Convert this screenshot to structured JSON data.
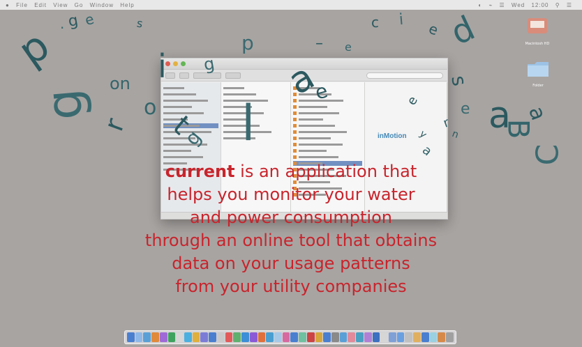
{
  "menubar": {
    "left_items": [
      "●",
      "File",
      "Edit",
      "View",
      "Go",
      "Window",
      "Help"
    ],
    "right_items": [
      "◐",
      "⌁",
      "☰",
      "Wed",
      "12:00",
      "⚲",
      "☰"
    ]
  },
  "window": {
    "col1_rows": 14,
    "col2_rows": 9,
    "col3_rows": 18,
    "logo_text": "inMotion",
    "status_text": "…"
  },
  "desktop_icons": [
    {
      "name": "hard-drive",
      "label": "Macintosh HD"
    },
    {
      "name": "folder",
      "label": "Folder"
    }
  ],
  "description": {
    "brand": "current",
    "lines": [
      " is an application that",
      "helps you monitor your water",
      "and power consumption",
      "through an online tool that obtains",
      "data on your usage patterns",
      "from your utility companies"
    ]
  },
  "floating_letters": [
    {
      "ch": "p",
      "size": 58,
      "rot": -35
    },
    {
      "ch": "·",
      "size": 20,
      "rot": 0
    },
    {
      "ch": "g",
      "size": 22,
      "rot": -10
    },
    {
      "ch": "e",
      "size": 20,
      "rot": -15
    },
    {
      "ch": "s",
      "size": 16,
      "rot": 10
    },
    {
      "ch": "p",
      "size": 28,
      "rot": 0
    },
    {
      "ch": "–",
      "size": 22,
      "rot": 0
    },
    {
      "ch": "e",
      "size": 16,
      "rot": 0
    },
    {
      "ch": "c",
      "size": 20,
      "rot": 0
    },
    {
      "ch": "i",
      "size": 22,
      "rot": -5
    },
    {
      "ch": "e",
      "size": 20,
      "rot": 20
    },
    {
      "ch": "d",
      "size": 48,
      "rot": -25
    },
    {
      "ch": "i",
      "size": 46,
      "rot": 0
    },
    {
      "ch": "g",
      "size": 24,
      "rot": -10
    },
    {
      "ch": "a",
      "size": 52,
      "rot": -30
    },
    {
      "ch": "on",
      "size": 24,
      "rot": 0
    },
    {
      "ch": "e",
      "size": 28,
      "rot": -15
    },
    {
      "ch": "g",
      "size": 70,
      "rot": -95
    },
    {
      "ch": "r",
      "size": 38,
      "rot": -70
    },
    {
      "ch": "o",
      "size": 30,
      "rot": 0
    },
    {
      "ch": "t",
      "size": 40,
      "rot": 40
    },
    {
      "ch": "l",
      "size": 70,
      "rot": 0
    },
    {
      "ch": "e",
      "size": 18,
      "rot": -60
    },
    {
      "ch": "a",
      "size": 18,
      "rot": 40
    },
    {
      "ch": "s",
      "size": 28,
      "rot": 80
    },
    {
      "ch": "e",
      "size": 22,
      "rot": 0
    },
    {
      "ch": "a",
      "size": 52,
      "rot": 0
    },
    {
      "ch": "B",
      "size": 42,
      "rot": 90
    },
    {
      "ch": "a",
      "size": 30,
      "rot": 70
    },
    {
      "ch": "C",
      "size": 44,
      "rot": -90
    },
    {
      "ch": "y",
      "size": 14,
      "rot": 40
    },
    {
      "ch": "r",
      "size": 18,
      "rot": -20
    },
    {
      "ch": "n",
      "size": 14,
      "rot": 20
    },
    {
      "ch": "g",
      "size": 28,
      "rot": -50
    }
  ],
  "dock_colors": [
    "#4a7fd0",
    "#8fb8e8",
    "#5aa0d6",
    "#e08a3c",
    "#a06ad6",
    "#3fa35f",
    "#d6d6d6",
    "#4bb0e0",
    "#e0b03c",
    "#7c7cd6",
    "#4a7fd0",
    "#c9c9c9",
    "#e25a5a",
    "#5fb06f",
    "#3c8ed6",
    "#8a5ad6",
    "#e0703c",
    "#4a9fd0",
    "#a6c9e8",
    "#d66aa0",
    "#4a7fd0",
    "#6fc0a0",
    "#c44",
    "#d6a63c",
    "#4a7fd0",
    "#8a8a8a",
    "#5a9fd6",
    "#e08a9a",
    "#4aa0c0",
    "#b080d6",
    "#3c70c0",
    "#d6d6d6",
    "#7fa0d6",
    "#6aa0e0",
    "#c0c0c0",
    "#e0b060",
    "#4a7fd0",
    "#9ad0e0",
    "#d68a4a",
    "#a0a0a0"
  ]
}
